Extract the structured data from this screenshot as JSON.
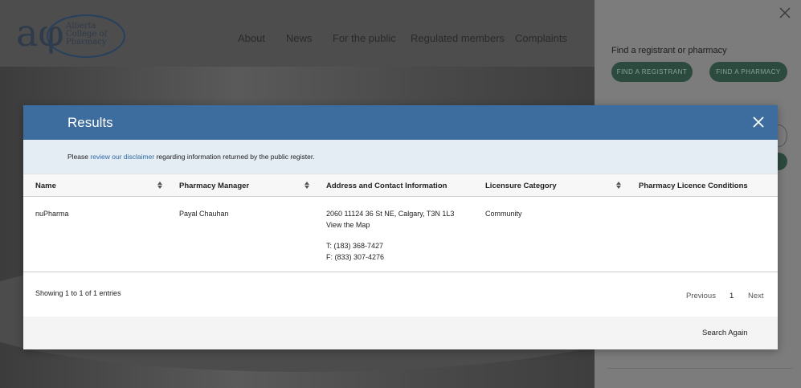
{
  "site": {
    "logo_mark": "aφ",
    "logo_lines": [
      "Alberta",
      "College of",
      "Pharmacy"
    ],
    "nav": [
      "About",
      "News",
      "For the public",
      "Regulated members",
      "Complaints"
    ]
  },
  "side_panel": {
    "title": "Find a registrant or pharmacy",
    "find_registrant": "FIND A REGISTRANT",
    "find_pharmacy": "FIND A PHARMACY"
  },
  "modal": {
    "title": "Results",
    "notice": {
      "before": "Please ",
      "link": "review our disclaimer",
      "after": " regarding information returned by the public register."
    },
    "columns": [
      "Name",
      "Pharmacy Manager",
      "Address and Contact Information",
      "Licensure Category",
      "Pharmacy Licence Conditions"
    ],
    "rows": [
      {
        "name": "nuPharma",
        "manager": "Payal Chauhan",
        "address": "2060 11124 36 St NE, Calgary, T3N 1L3",
        "map_link": "View the Map",
        "phone": "T: (183) 368-7427",
        "fax": "F: (833) 307-4276",
        "category": "Community",
        "conditions": ""
      }
    ],
    "info": "Showing 1 to 1 of 1 entries",
    "pagination": {
      "previous": "Previous",
      "page": "1",
      "next": "Next"
    },
    "search_again": "Search Again"
  },
  "colors": {
    "modal_header": "#3d6c9e",
    "notice_bg": "#e4ecf4",
    "link": "#2e6aa5",
    "pill_bg": "#2d4a3f"
  }
}
